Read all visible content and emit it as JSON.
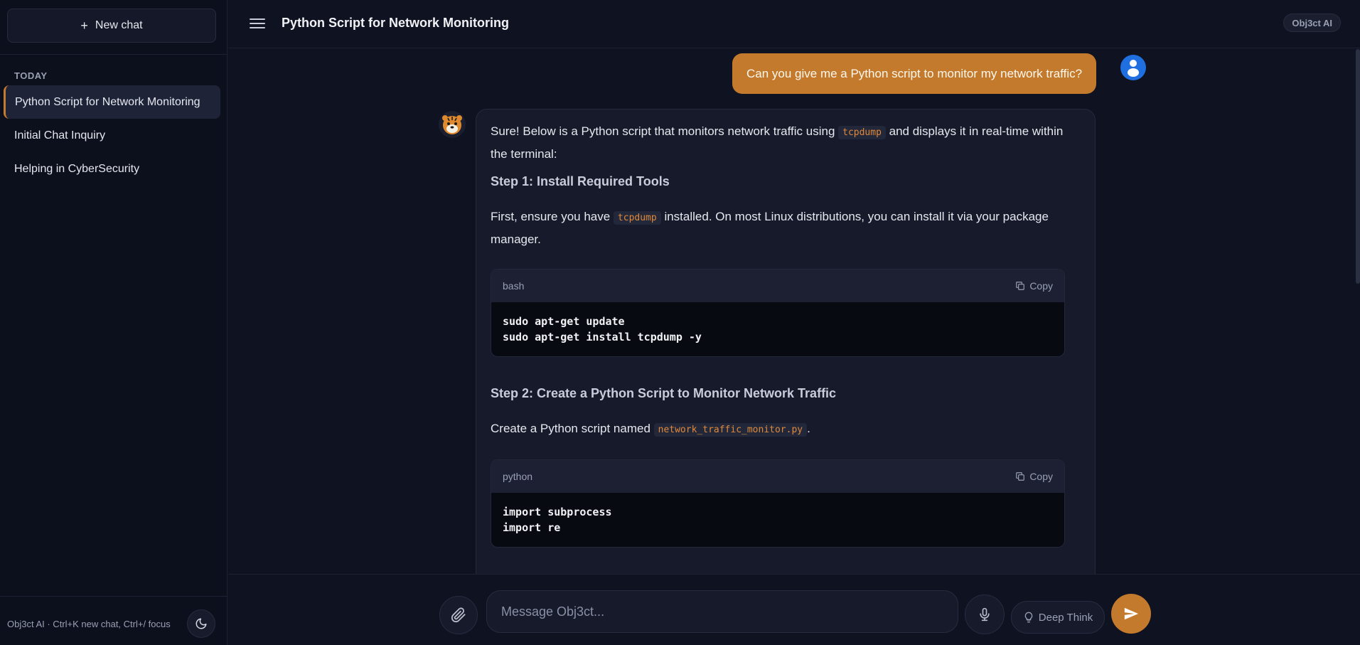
{
  "sidebar": {
    "new_chat_label": "New chat",
    "section_label": "TODAY",
    "items": [
      {
        "label": "Python Script for Network Monitoring"
      },
      {
        "label": "Initial Chat Inquiry"
      },
      {
        "label": "Helping in CyberSecurity"
      }
    ],
    "footer_text": "Obj3ct AI · Ctrl+K new chat, Ctrl+/ focus"
  },
  "header": {
    "title": "Python Script for Network Monitoring",
    "brand": "Obj3ct AI"
  },
  "chat": {
    "user_message": "Can you give me a Python script to monitor my network traffic?",
    "bot": {
      "intro_before": "Sure! Below is a Python script that monitors network traffic using ",
      "intro_code": "tcpdump",
      "intro_after": " and displays it in real-time within the terminal:",
      "step1_heading": "Step 1: Install Required Tools",
      "step1_before": "First, ensure you have ",
      "step1_code": "tcpdump",
      "step1_after": " installed. On most Linux distributions, you can install it via your package manager.",
      "code1_lang": "bash",
      "code1_copy": "Copy",
      "code1_body": "sudo apt-get update\nsudo apt-get install tcpdump -y",
      "step2_heading": "Step 2: Create a Python Script to Monitor Network Traffic",
      "step2_before": "Create a Python script named ",
      "step2_code": "network_traffic_monitor.py",
      "step2_after": ".",
      "code2_lang": "python",
      "code2_copy": "Copy",
      "code2_body": "import subprocess\nimport re"
    }
  },
  "composer": {
    "placeholder": "Message Obj3ct...",
    "deep_think_label": "Deep Think"
  },
  "colors": {
    "accent": "#c47a2c",
    "user_avatar": "#1f6fe0",
    "background": "#0f1220"
  }
}
